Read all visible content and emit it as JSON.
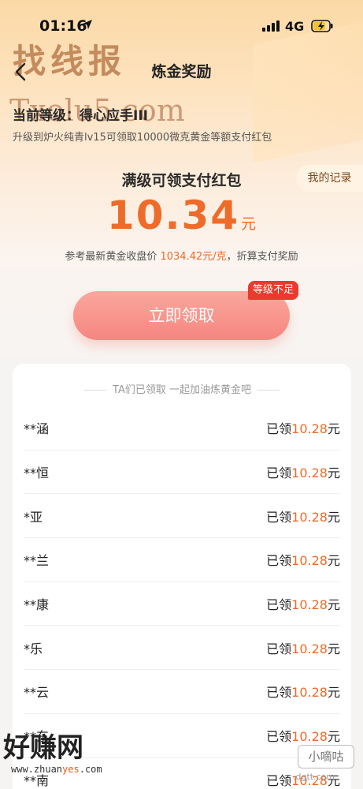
{
  "status_bar": {
    "time": "01:16",
    "network": "4G"
  },
  "nav": {
    "title": "炼金奖励"
  },
  "watermarks": {
    "top_brand": "找线报",
    "top_url": "Txolu5.com",
    "bottom_brand": "好赚网",
    "bottom_url_prefix": "www.zhuan",
    "bottom_url_highlight": "yes",
    "bottom_url_suffix": ".com",
    "xiao": "小嘀咕",
    "xiao_site": ".dgtt.com"
  },
  "level": {
    "prefix": "当前等级：",
    "value": "得心应手III",
    "upgrade_note": "升级到炉火纯青lv15可领取10000微克黄金等额支付红包"
  },
  "record_button": "我的记录",
  "reward": {
    "title": "满级可领支付红包",
    "amount": "10.34",
    "unit": "元",
    "ref_prefix": "参考最新黄金收盘价 ",
    "ref_price": "1034.42元/克",
    "ref_suffix": "，折算支付奖励"
  },
  "claim": {
    "label": "立即领取",
    "badge": "等级不足"
  },
  "list": {
    "header": "TA们已领取 一起加油炼黄金吧",
    "claimed_prefix": "已领",
    "unit": "元",
    "rows": [
      {
        "name": "**涵",
        "amount": "10.28"
      },
      {
        "name": "**恒",
        "amount": "10.28"
      },
      {
        "name": "*亚",
        "amount": "10.28"
      },
      {
        "name": "**兰",
        "amount": "10.28"
      },
      {
        "name": "**康",
        "amount": "10.28"
      },
      {
        "name": "*乐",
        "amount": "10.28"
      },
      {
        "name": "**云",
        "amount": "10.28"
      },
      {
        "name": "**东",
        "amount": "10.28"
      },
      {
        "name": "**南",
        "amount": "10.28"
      }
    ]
  },
  "colors": {
    "accent": "#ee6b2a",
    "badge": "#ea3a2d",
    "button": "#f8837a"
  }
}
